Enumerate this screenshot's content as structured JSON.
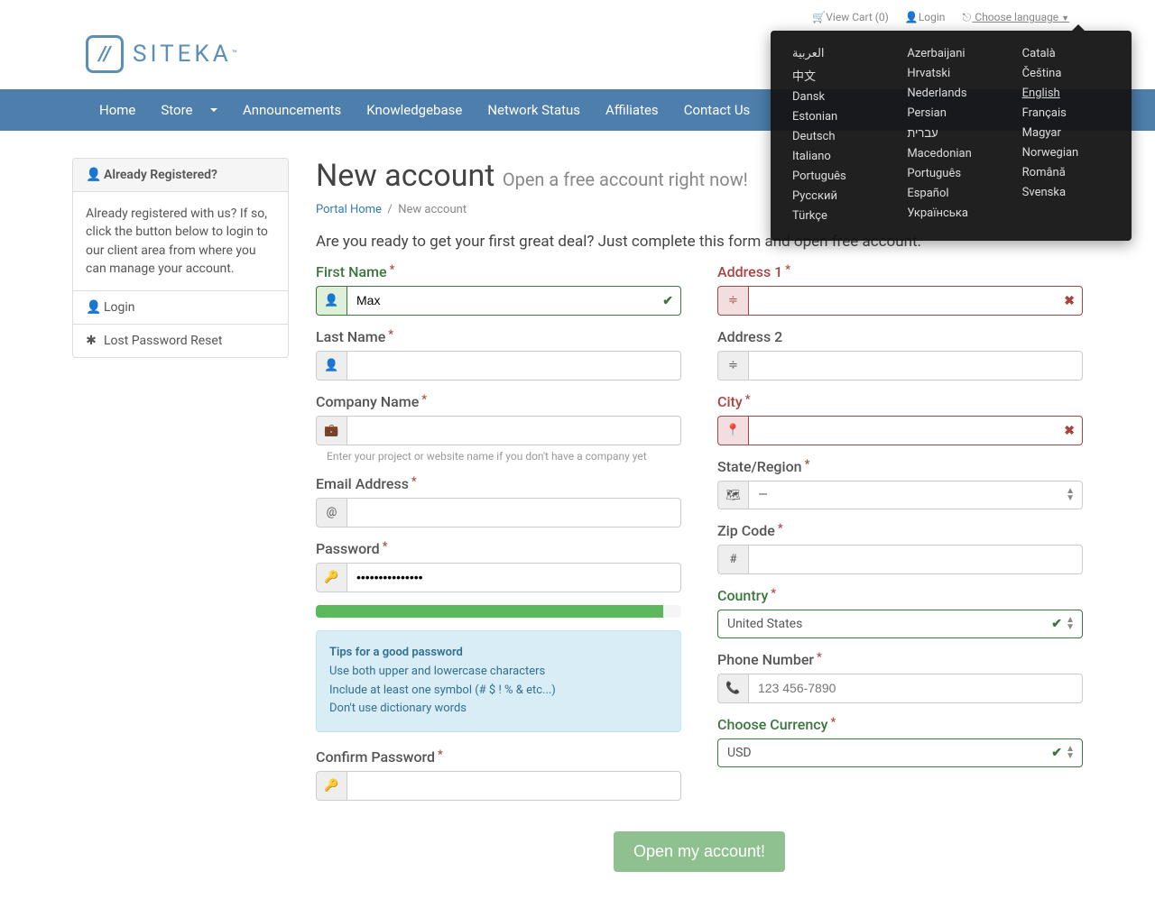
{
  "topbar": {
    "view_cart": "View Cart (0)",
    "login": "Login",
    "choose_lang": "Choose language"
  },
  "logo": {
    "text": "SITEKA"
  },
  "nav": [
    "Home",
    "Store",
    "Announcements",
    "Knowledgebase",
    "Network Status",
    "Affiliates",
    "Contact Us"
  ],
  "sidebar": {
    "hd": "Already Registered?",
    "body": "Already registered with us? If so, click the button below to login to our client area from where you can manage your account.",
    "login": "Login",
    "reset": "Lost Password Reset"
  },
  "page": {
    "title": "New account",
    "sub": "Open a free account right now!",
    "bc_home": "Portal Home",
    "bc_cur": "New account",
    "lead": "Are you ready to get your first great deal? Just complete this form and open free account."
  },
  "form": {
    "first_name": {
      "label": "First Name",
      "value": "Max"
    },
    "last_name": {
      "label": "Last Name",
      "value": ""
    },
    "company": {
      "label": "Company Name",
      "value": "",
      "help": "Enter your project or website name if you don't have a company yet"
    },
    "email": {
      "label": "Email Address",
      "value": ""
    },
    "password": {
      "label": "Password",
      "value": "•••••••••••••••"
    },
    "confirm": {
      "label": "Confirm Password",
      "value": ""
    },
    "address1": {
      "label": "Address 1",
      "value": ""
    },
    "address2": {
      "label": "Address 2",
      "value": ""
    },
    "city": {
      "label": "City",
      "value": ""
    },
    "state": {
      "label": "State/Region",
      "value": "—"
    },
    "zip": {
      "label": "Zip Code",
      "value": ""
    },
    "country": {
      "label": "Country",
      "value": "United States"
    },
    "phone": {
      "label": "Phone Number",
      "value": "",
      "ph": "123 456-7890"
    },
    "currency": {
      "label": "Choose Currency",
      "value": "USD"
    }
  },
  "tips": {
    "hd": "Tips for a good password",
    "l1": "Use both upper and lowercase characters",
    "l2": "Include at least one symbol (# $ ! % & etc...)",
    "l3": "Don't use dictionary words"
  },
  "submit": "Open my account!",
  "langs": {
    "c1": [
      "العربية",
      "中文",
      "Dansk",
      "Estonian",
      "Deutsch",
      "Italiano",
      "Português",
      "Русский",
      "Türkçe"
    ],
    "c2": [
      "Azerbaijani",
      "Hrvatski",
      "Nederlands",
      "Persian",
      "עברית",
      "Macedonian",
      "Português",
      "Español",
      "Українська"
    ],
    "c3": [
      "Català",
      "Čeština",
      "English",
      "Français",
      "Magyar",
      "Norwegian",
      "Română",
      "Svenska"
    ]
  }
}
